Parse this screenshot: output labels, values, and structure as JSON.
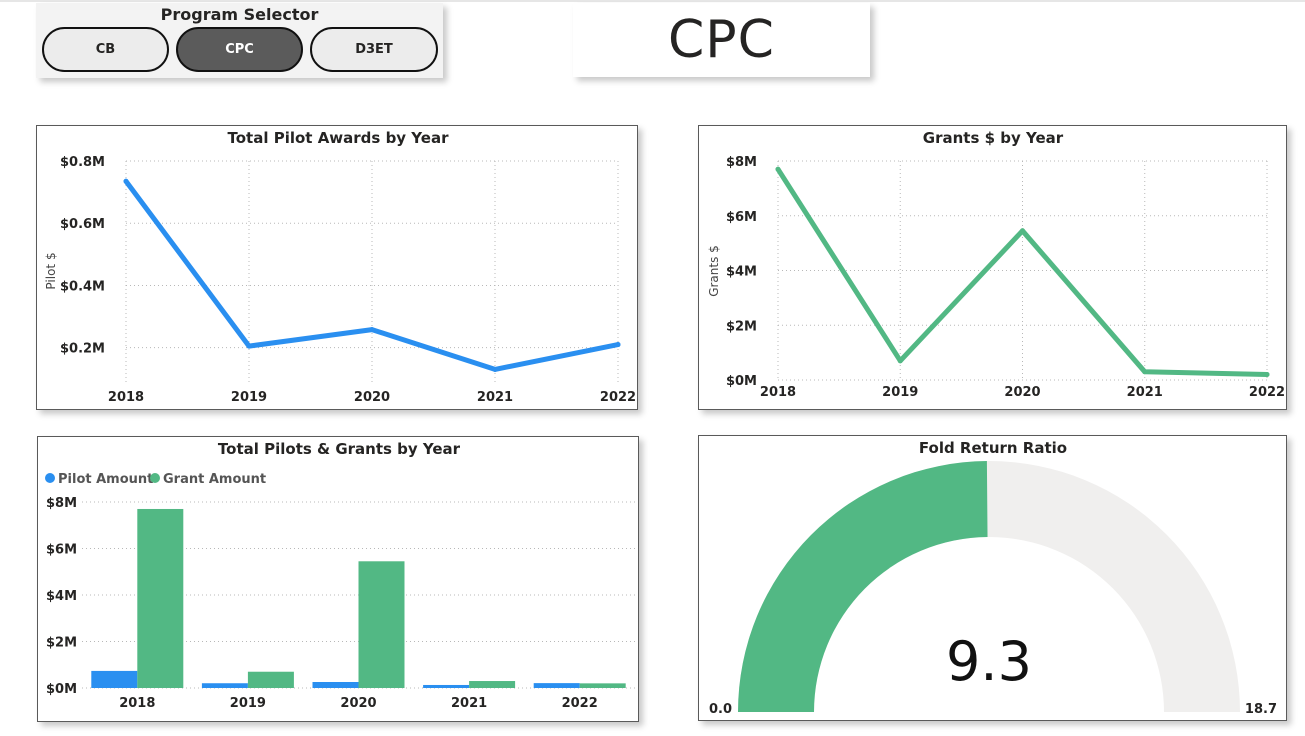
{
  "selector": {
    "title": "Program Selector",
    "options": [
      "CB",
      "CPC",
      "D3ET"
    ],
    "selected": "CPC"
  },
  "program_display": "CPC",
  "colors": {
    "pilot": "#2a8ff0",
    "grant": "#52b884",
    "gauge_bg": "#f0efee",
    "selected_pill": "#5b5b5b"
  },
  "chart_data": [
    {
      "type": "line",
      "title": "Total Pilot Awards by Year",
      "ylabel": "Pilot $",
      "xlabel": "",
      "categories": [
        "2018",
        "2019",
        "2020",
        "2021",
        "2022"
      ],
      "series": [
        {
          "values": [
            0.735,
            0.205,
            0.258,
            0.13,
            0.21
          ]
        }
      ],
      "yticks": [
        0.2,
        0.4,
        0.6,
        0.8
      ],
      "ytick_labels": [
        "$0.2M",
        "$0.4M",
        "$0.6M",
        "$0.8M"
      ],
      "ylim": [
        0.08,
        0.8
      ],
      "units": "$M",
      "grid": true
    },
    {
      "type": "line",
      "title": "Grants $ by Year",
      "ylabel": "Grants $",
      "xlabel": "",
      "categories": [
        "2018",
        "2019",
        "2020",
        "2021",
        "2022"
      ],
      "series": [
        {
          "values": [
            7.7,
            0.7,
            5.45,
            0.3,
            0.2
          ]
        }
      ],
      "yticks": [
        0,
        2,
        4,
        6,
        8
      ],
      "ytick_labels": [
        "$0M",
        "$2M",
        "$4M",
        "$6M",
        "$8M"
      ],
      "ylim": [
        0,
        8
      ],
      "units": "$M",
      "grid": true
    },
    {
      "type": "bar",
      "title": "Total Pilots & Grants by Year",
      "categories": [
        "2018",
        "2019",
        "2020",
        "2021",
        "2022"
      ],
      "series": [
        {
          "name": "Pilot Amount",
          "values": [
            0.735,
            0.205,
            0.258,
            0.13,
            0.21
          ]
        },
        {
          "name": "Grant Amount",
          "values": [
            7.7,
            0.7,
            5.45,
            0.3,
            0.2
          ]
        }
      ],
      "yticks": [
        0,
        2,
        4,
        6,
        8
      ],
      "ytick_labels": [
        "$0M",
        "$2M",
        "$4M",
        "$6M",
        "$8M"
      ],
      "ylim": [
        0,
        8
      ],
      "units": "$M",
      "legend": "top-left",
      "grid": true
    },
    {
      "type": "gauge",
      "title": "Fold Return Ratio",
      "value": 9.3,
      "value_label": "9.3",
      "min": 0,
      "max": 18.7,
      "min_label": "0.0",
      "max_label": "18.7"
    }
  ]
}
